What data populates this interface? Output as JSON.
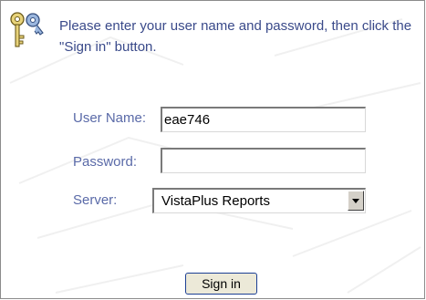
{
  "instructions": "Please enter your user name and password, then click the \"Sign in\" button.",
  "form": {
    "username_label": "User Name:",
    "username_value": "eae746",
    "password_label": "Password:",
    "password_value": "",
    "server_label": "Server:",
    "server_value": "VistaPlus Reports"
  },
  "buttons": {
    "sign_in": "Sign in"
  },
  "icons": {
    "keys": "keys-icon",
    "dropdown_arrow": "chevron-down-icon"
  },
  "colors": {
    "instruction_text": "#3a4a8a",
    "label_text": "#5a6aa8",
    "button_border": "#1c3f94"
  }
}
